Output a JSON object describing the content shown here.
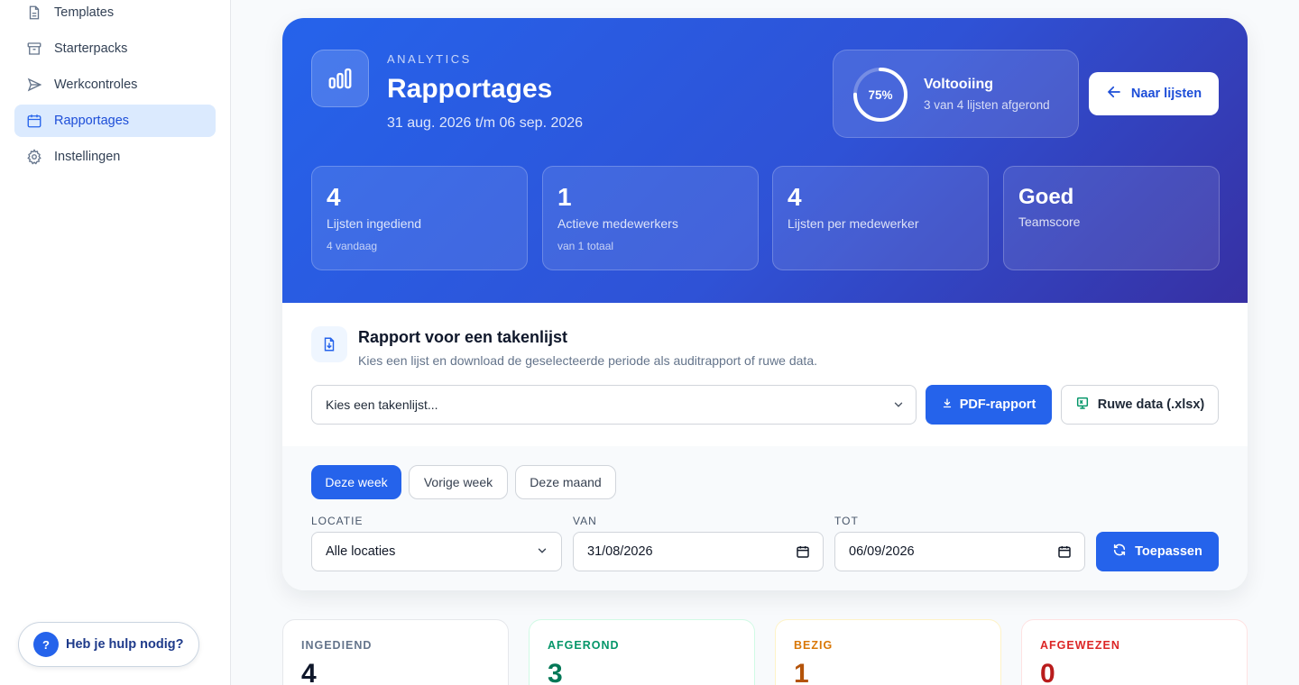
{
  "sidebar": {
    "items": [
      {
        "label": "Templates",
        "icon": "document-icon"
      },
      {
        "label": "Starterpacks",
        "icon": "archive-icon"
      },
      {
        "label": "Werkcontroles",
        "icon": "send-icon"
      },
      {
        "label": "Rapportages",
        "icon": "calendar-icon",
        "active": true
      },
      {
        "label": "Instellingen",
        "icon": "gear-icon"
      }
    ],
    "help": {
      "label": "Heb je hulp nodig?",
      "icon_text": "?"
    }
  },
  "hero": {
    "eyebrow": "ANALYTICS",
    "title": "Rapportages",
    "date_range": "31 aug. 2026 t/m 06 sep. 2026",
    "progress": {
      "percent_label": "75%",
      "value": 0.75,
      "title": "Voltooiing",
      "subtitle": "3 van 4 lijsten afgerond"
    },
    "back_button": "Naar lijsten",
    "stats": [
      {
        "value": "4",
        "label": "Lijsten ingediend",
        "sub": "4 vandaag"
      },
      {
        "value": "1",
        "label": "Actieve medewerkers",
        "sub": "van 1 totaal"
      },
      {
        "value": "4",
        "label": "Lijsten per medewerker",
        "sub": ""
      },
      {
        "value": "Goed",
        "label": "Teamscore",
        "sub": ""
      }
    ]
  },
  "report": {
    "title": "Rapport voor een takenlijst",
    "subtitle": "Kies een lijst en download de geselecteerde periode als auditrapport of ruwe data.",
    "select_placeholder": "Kies een takenlijst...",
    "pdf_button": "PDF-rapport",
    "xlsx_button": "Ruwe data (.xlsx)"
  },
  "filters": {
    "periods": [
      "Deze week",
      "Vorige week",
      "Deze maand"
    ],
    "active_period": "Deze week",
    "location_label": "LOCATIE",
    "location_value": "Alle locaties",
    "from_label": "VAN",
    "from_value": "31/08/2026",
    "to_label": "TOT",
    "to_value": "06/09/2026",
    "apply_button": "Toepassen"
  },
  "status_cards": [
    {
      "label": "INGEDIEND",
      "value": "4",
      "color": "#64748b",
      "num_color": "#0f172a"
    },
    {
      "label": "AFGEROND",
      "value": "3",
      "color": "#059669",
      "num_color": "#047857"
    },
    {
      "label": "BEZIG",
      "value": "1",
      "color": "#d97706",
      "num_color": "#b45309"
    },
    {
      "label": "AFGEWEZEN",
      "value": "0",
      "color": "#dc2626",
      "num_color": "#b91c1c"
    }
  ],
  "colors": {
    "accent": "#2563eb",
    "hero_start": "#2563eb",
    "hero_end": "#3730a3"
  }
}
